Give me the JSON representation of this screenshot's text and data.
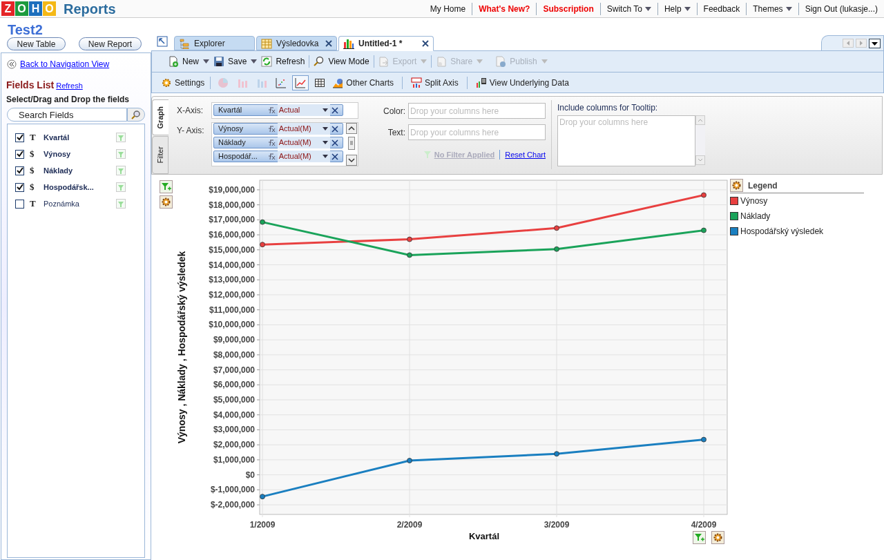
{
  "brand": {
    "logo_letters": [
      "Z",
      "O",
      "H",
      "O"
    ],
    "product": "Reports"
  },
  "top_nav": [
    {
      "label": "My Home",
      "highlight": false,
      "has_menu": false
    },
    {
      "label": "What's New?",
      "highlight": true,
      "has_menu": false
    },
    {
      "label": "Subscription",
      "highlight": true,
      "has_menu": false
    },
    {
      "label": "Switch To",
      "highlight": false,
      "has_menu": true
    },
    {
      "label": "Help",
      "highlight": false,
      "has_menu": true
    },
    {
      "label": "Feedback",
      "highlight": false,
      "has_menu": false
    },
    {
      "label": "Themes",
      "highlight": false,
      "has_menu": true
    },
    {
      "label": "Sign Out (lukasje...)",
      "highlight": false,
      "has_menu": false
    }
  ],
  "database_title": "Test2",
  "side_buttons": [
    "New Table",
    "New Report"
  ],
  "tabs": [
    {
      "label": "Explorer",
      "kind": "explorer",
      "closable": false,
      "selected": false
    },
    {
      "label": "Výsledovka",
      "kind": "table",
      "closable": true,
      "selected": false
    },
    {
      "label": "Untitled-1 *",
      "kind": "chart",
      "closable": true,
      "selected": true
    }
  ],
  "sidebar": {
    "back_link": "Back to Navigation View",
    "title": "Fields List",
    "refresh": "Refresh",
    "hint": "Select/Drag and Drop the fields",
    "search_placeholder": "Search Fields",
    "fields": [
      {
        "type": "T",
        "name": "Kvartál",
        "checked": true
      },
      {
        "type": "$",
        "name": "Výnosy",
        "checked": true
      },
      {
        "type": "$",
        "name": "Náklady",
        "checked": true
      },
      {
        "type": "$",
        "name": "Hospodářsk...",
        "checked": true
      },
      {
        "type": "T",
        "name": "Poznámka",
        "checked": false
      }
    ]
  },
  "toolbar": [
    {
      "label": "New",
      "kind": "new",
      "has_menu": true,
      "disabled": false
    },
    {
      "label": "Save",
      "kind": "save",
      "has_menu": true,
      "disabled": false
    },
    {
      "label": "Refresh",
      "kind": "refresh",
      "has_menu": false,
      "disabled": false
    },
    {
      "label": "View Mode",
      "kind": "view",
      "has_menu": false,
      "disabled": false
    },
    {
      "label": "Export",
      "kind": "export",
      "has_menu": true,
      "disabled": true
    },
    {
      "label": "Share",
      "kind": "share",
      "has_menu": true,
      "disabled": true
    },
    {
      "label": "Publish",
      "kind": "publish",
      "has_menu": true,
      "disabled": true
    }
  ],
  "chart_toolbar": {
    "settings": "Settings",
    "chart_types": [
      {
        "kind": "pie",
        "selected": false,
        "disabled": true
      },
      {
        "kind": "bar",
        "selected": false,
        "disabled": true
      },
      {
        "kind": "stacked",
        "selected": false,
        "disabled": true
      },
      {
        "kind": "scatter",
        "selected": false,
        "disabled": false
      },
      {
        "kind": "line",
        "selected": true,
        "disabled": false
      },
      {
        "kind": "table",
        "selected": false,
        "disabled": false
      }
    ],
    "other_charts": "Other Charts",
    "split_axis": "Split Axis",
    "view_data": "View Underlying Data"
  },
  "config": {
    "side_tabs": [
      {
        "label": "Graph",
        "selected": true
      },
      {
        "label": "Filter",
        "selected": false
      }
    ],
    "x_axis_label": "X-Axis:",
    "x_axis": [
      {
        "name": "Kvartál",
        "aggregate": "Actual"
      }
    ],
    "y_axis_label": "Y- Axis:",
    "y_axis": [
      {
        "name": "Výnosy",
        "aggregate": "Actual(M)"
      },
      {
        "name": "Náklady",
        "aggregate": "Actual(M)"
      },
      {
        "name": "Hospodář...",
        "aggregate": "Actual(M)"
      }
    ],
    "color_label": "Color:",
    "color_placeholder": "Drop your columns here",
    "text_label": "Text:",
    "text_placeholder": "Drop your columns here",
    "no_filter": "No Filter Applied",
    "reset_chart": "Reset Chart",
    "tooltip_label": "Include columns for Tooltip:",
    "tooltip_placeholder": "Drop your columns here"
  },
  "legend": {
    "title": "Legend"
  },
  "chart_data": {
    "type": "line",
    "grid": true,
    "xlabel": "Kvartál",
    "ylabel": "Výnosy , Náklady , Hospodářský výsledek",
    "categories": [
      "1/2009",
      "2/2009",
      "3/2009",
      "4/2009"
    ],
    "series": [
      {
        "name": "Výnosy",
        "color": "#e84040",
        "marker": "circle",
        "values": [
          15350000,
          15700000,
          16450000,
          18650000
        ]
      },
      {
        "name": "Náklady",
        "color": "#1aa35a",
        "marker": "circle",
        "values": [
          16850000,
          14650000,
          15050000,
          16300000
        ]
      },
      {
        "name": "Hospodářský výsledek",
        "color": "#1a7fc0",
        "marker": "circle",
        "values": [
          -1450000,
          950000,
          1400000,
          2350000
        ]
      }
    ],
    "ylim": [
      -2640000,
      19640000
    ],
    "yticks": [
      {
        "value": 19000000,
        "label": "$19,000,000"
      },
      {
        "value": 18000000,
        "label": "$18,000,000"
      },
      {
        "value": 17000000,
        "label": "$17,000,000"
      },
      {
        "value": 16000000,
        "label": "$16,000,000"
      },
      {
        "value": 15000000,
        "label": "$15,000,000"
      },
      {
        "value": 14000000,
        "label": "$14,000,000"
      },
      {
        "value": 13000000,
        "label": "$13,000,000"
      },
      {
        "value": 12000000,
        "label": "$12,000,000"
      },
      {
        "value": 11000000,
        "label": "$11,000,000"
      },
      {
        "value": 10000000,
        "label": "$10,000,000"
      },
      {
        "value": 9000000,
        "label": "$9,000,000"
      },
      {
        "value": 8000000,
        "label": "$8,000,000"
      },
      {
        "value": 7000000,
        "label": "$7,000,000"
      },
      {
        "value": 6000000,
        "label": "$6,000,000"
      },
      {
        "value": 5000000,
        "label": "$5,000,000"
      },
      {
        "value": 4000000,
        "label": "$4,000,000"
      },
      {
        "value": 3000000,
        "label": "$3,000,000"
      },
      {
        "value": 2000000,
        "label": "$2,000,000"
      },
      {
        "value": 1000000,
        "label": "$1,000,000"
      },
      {
        "value": 0,
        "label": "$0"
      },
      {
        "value": -1000000,
        "label": "$-1,000,000"
      },
      {
        "value": -2000000,
        "label": "$-2,000,000"
      }
    ]
  }
}
